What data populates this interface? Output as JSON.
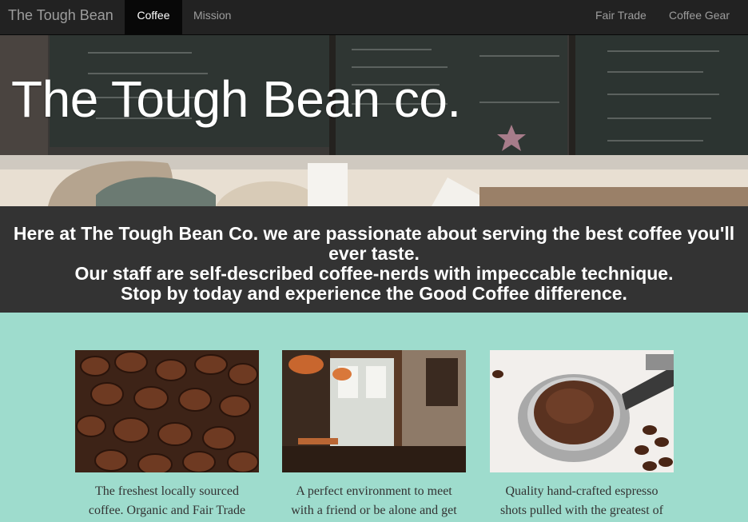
{
  "navbar": {
    "brand": "The Tough Bean",
    "left_items": [
      "Coffee",
      "Mission"
    ],
    "active_item": "Coffee",
    "right_items": [
      "Fair Trade",
      "Coffee Gear"
    ],
    "dropdown_item": "Coffee Gear",
    "dropdown_icon": "caret-down-icon"
  },
  "hero": {
    "title": "The Tough Bean co.",
    "background": "cafe-chalkboard-menu-photo"
  },
  "intro": {
    "line1": "Here at The Tough Bean Co. we are passionate about serving the best coffee you'll ever taste.",
    "line2": "Our staff are self-described coffee-nerds with impeccable technique.",
    "line3": "Stop by today and experience the Good Coffee difference."
  },
  "features": [
    {
      "image": "coffee-beans-photo",
      "caption": "The freshest locally sourced coffee. Organic and Fair Trade"
    },
    {
      "image": "cafe-interior-photo",
      "caption": "A perfect environment to meet with a friend or be alone and get"
    },
    {
      "image": "espresso-portafilter-photo",
      "caption": "Quality hand-crafted espresso shots pulled with the greatest of"
    }
  ],
  "colors": {
    "navbar_bg": "#222222",
    "intro_bg": "#333333",
    "page_bg": "#9edccd"
  }
}
